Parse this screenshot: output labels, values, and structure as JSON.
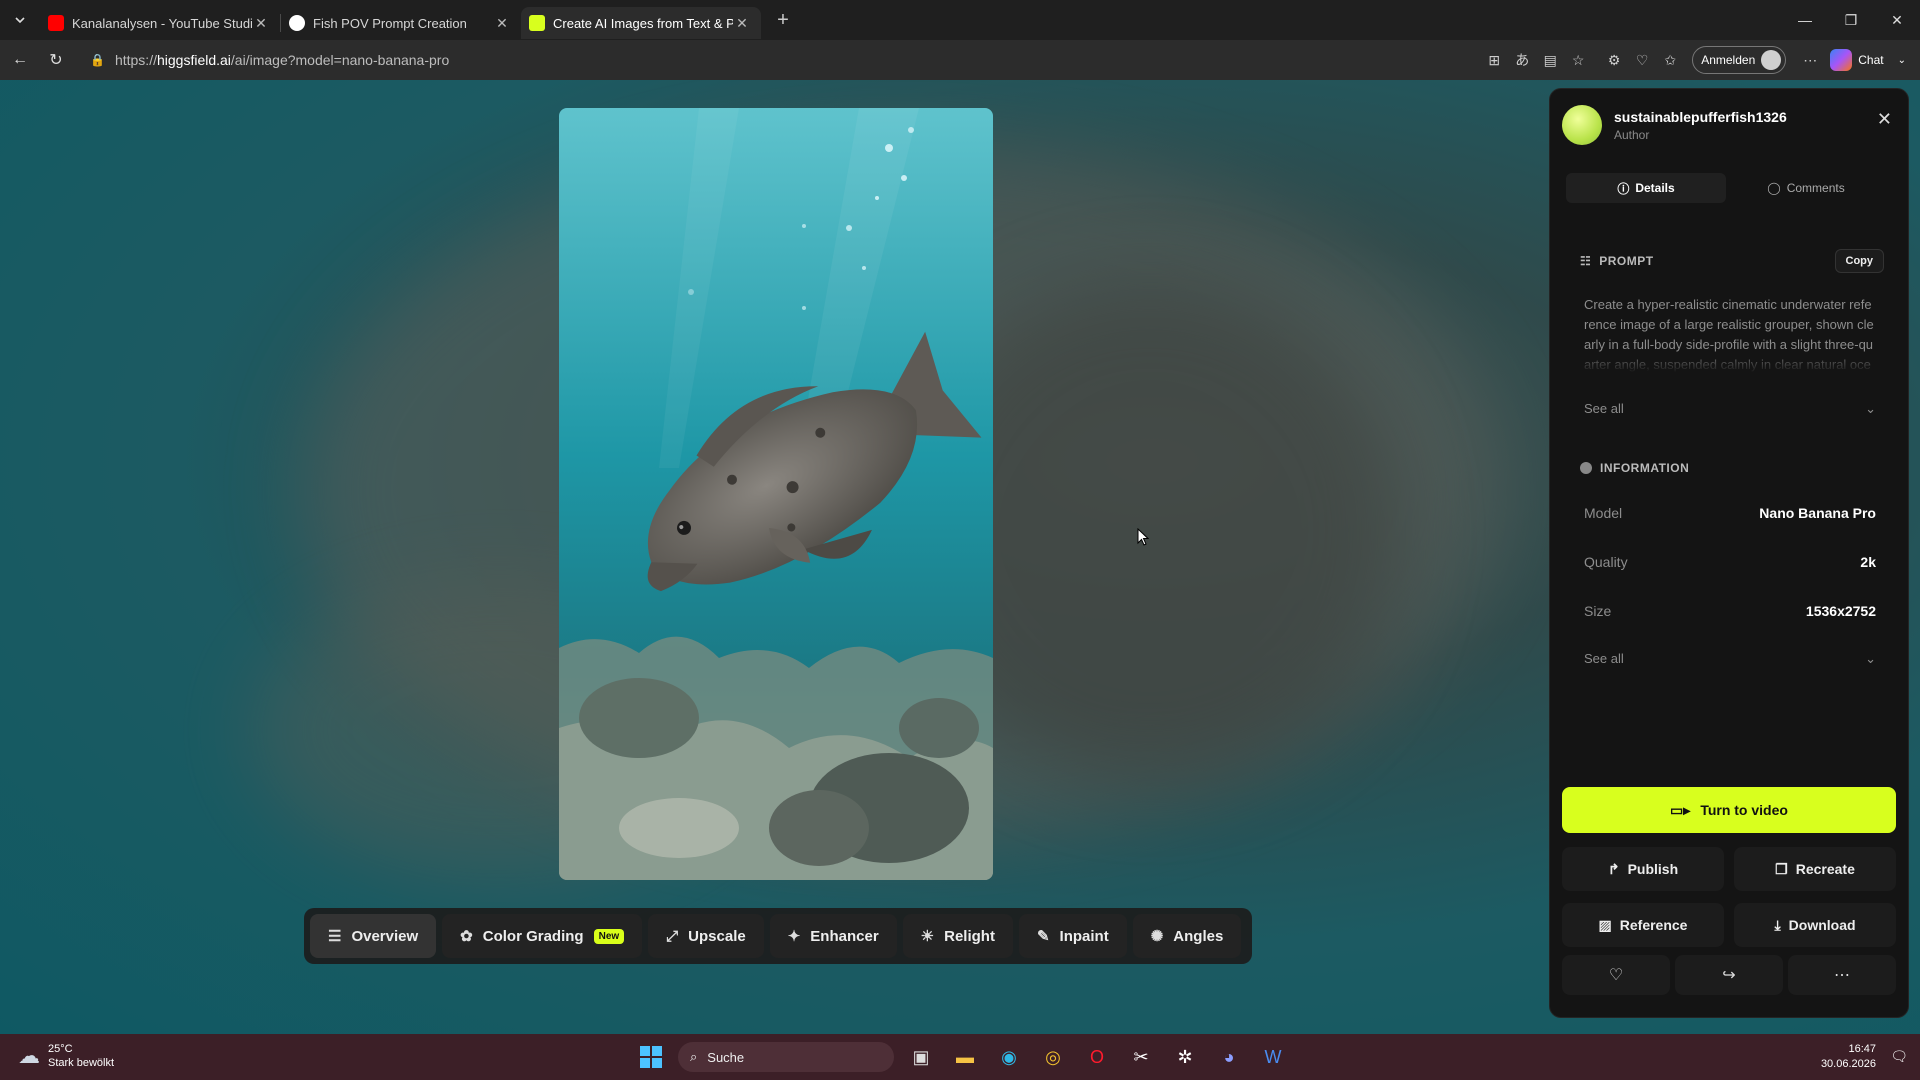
{
  "browser": {
    "tabs": [
      {
        "title": "Kanalanalysen - YouTube Studio",
        "favicon_color": "#ff0000"
      },
      {
        "title": "Fish POV Prompt Creation",
        "favicon_color": "#ffffff"
      },
      {
        "title": "Create AI Images from Text & Pho",
        "favicon_color": "#d8ff1e"
      }
    ],
    "url_prefix": "https://",
    "url_host": "higgsfield.ai",
    "url_path": "/ai/image?model=nano-banana-pro",
    "signin_label": "Anmelden",
    "chat_label": "Chat"
  },
  "toolbar": {
    "overview": "Overview",
    "color_grading": "Color Grading",
    "new_badge": "New",
    "upscale": "Upscale",
    "enhancer": "Enhancer",
    "relight": "Relight",
    "inpaint": "Inpaint",
    "angles": "Angles"
  },
  "panel": {
    "author_name": "sustainablepufferfish1326",
    "author_role": "Author",
    "tab_details": "Details",
    "tab_comments": "Comments",
    "prompt_heading": "PROMPT",
    "copy_label": "Copy",
    "prompt_text": "Create a hyper-realistic cinematic underwater reference image of a large realistic grouper, shown clearly in a full-body side-profile with a slight three-quarter angle, suspended calmly in clear natural ocean water. The fish is a stron",
    "see_all": "See all",
    "info_heading": "INFORMATION",
    "info": [
      {
        "key": "Model",
        "value": "Nano Banana Pro"
      },
      {
        "key": "Quality",
        "value": "2k"
      },
      {
        "key": "Size",
        "value": "1536x2752"
      }
    ],
    "see_all_info": "See all",
    "turn_to_video": "Turn to video",
    "publish": "Publish",
    "recreate": "Recreate",
    "reference": "Reference",
    "download": "Download"
  },
  "taskbar": {
    "temperature": "25°C",
    "weather": "Stark bewölkt",
    "search_placeholder": "Suche",
    "time": "16:47",
    "date": "30.06.2026"
  },
  "colors": {
    "accent": "#d8ff1e",
    "panel_bg": "#141414",
    "taskbar_bg": "#3c1f27"
  }
}
